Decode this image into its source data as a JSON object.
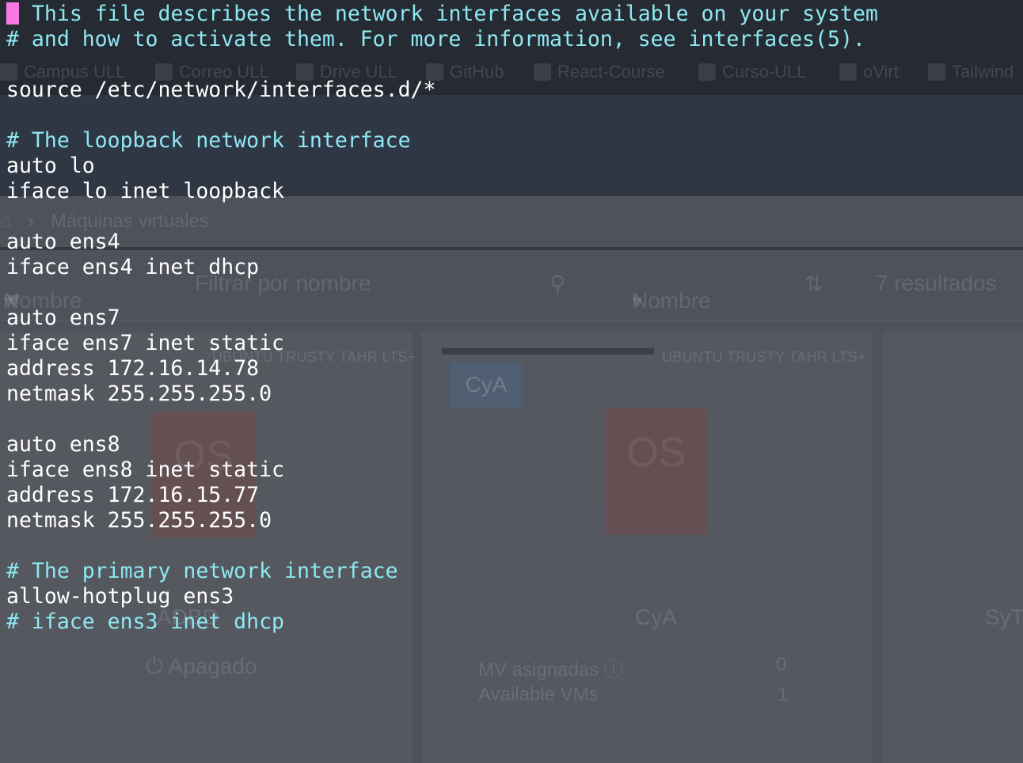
{
  "terminal": {
    "cursor_char": "#",
    "lines": [
      {
        "type": "comment",
        "text": " This file describes the network interfaces available on your system"
      },
      {
        "type": "comment",
        "text": "# and how to activate them. For more information, see interfaces(5)."
      },
      {
        "type": "blank",
        "text": ""
      },
      {
        "type": "code",
        "text": "source /etc/network/interfaces.d/*"
      },
      {
        "type": "blank",
        "text": ""
      },
      {
        "type": "comment",
        "text": "# The loopback network interface"
      },
      {
        "type": "code",
        "text": "auto lo"
      },
      {
        "type": "code",
        "text": "iface lo inet loopback"
      },
      {
        "type": "blank",
        "text": ""
      },
      {
        "type": "code",
        "text": "auto ens4"
      },
      {
        "type": "code",
        "text": "iface ens4 inet dhcp"
      },
      {
        "type": "blank",
        "text": ""
      },
      {
        "type": "code",
        "text": "auto ens7"
      },
      {
        "type": "code",
        "text": "iface ens7 inet static"
      },
      {
        "type": "code",
        "text": "address 172.16.14.78"
      },
      {
        "type": "code",
        "text": "netmask 255.255.255.0"
      },
      {
        "type": "blank",
        "text": ""
      },
      {
        "type": "code",
        "text": "auto ens8"
      },
      {
        "type": "code",
        "text": "iface ens8 inet static"
      },
      {
        "type": "code",
        "text": "address 172.16.15.77"
      },
      {
        "type": "code",
        "text": "netmask 255.255.255.0"
      },
      {
        "type": "blank",
        "text": ""
      },
      {
        "type": "comment",
        "text": "# The primary network interface"
      },
      {
        "type": "code",
        "text": "allow-hotplug ens3"
      },
      {
        "type": "comment",
        "text": "# iface ens3 inet dhcp"
      }
    ]
  },
  "background": {
    "bookmarks": [
      "Campus ULL",
      "Correo ULL",
      "Drive ULL",
      "GitHub",
      "React-Course",
      "Curso-ULL",
      "oVirt",
      "Tailwind"
    ],
    "breadcrumb": "Máquinas virtuales",
    "filter_type": "Nombre",
    "filter_placeholder": "Filtrar por nombre",
    "sort_label": "Nombre",
    "results": "7 resultados",
    "card_tag": "UBUNTU TRUSTY TAHR LTS+",
    "card_chip": "CyA",
    "card_name_left": "ADBD",
    "card_name_mid": "CyA",
    "card_name_right": "SyT",
    "status": "Apagado",
    "stat_assigned_label": "MV asignadas",
    "stat_assigned_value": "0",
    "stat_available_label": "Available VMs",
    "stat_available_value": "1",
    "os_glyph": "OS",
    "colors": {
      "terminal_background": "#4f525a",
      "code_text": "#ffffff",
      "comment_text": "#8ee8f2",
      "cursor": "#f77ae0"
    }
  }
}
